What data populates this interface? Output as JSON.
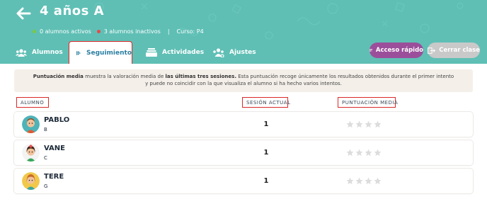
{
  "header": {
    "title": "4 años A",
    "active_label": "0 alumnos activos",
    "inactive_label": "3 alumnos inactivos",
    "separator": "|",
    "course_label": "Curso: P4",
    "colors": {
      "background": "#5fbfb5",
      "active_dot": "#7ac943",
      "inactive_dot": "#e84a4a"
    }
  },
  "tabs": [
    {
      "label": "Alumnos",
      "icon": "users-icon"
    },
    {
      "label": "Seguimiento",
      "icon": "chart-bars-icon",
      "active": true
    },
    {
      "label": "Actividades",
      "icon": "stack-icon"
    },
    {
      "label": "Ajustes",
      "icon": "users-gear-icon"
    }
  ],
  "actions": {
    "quick_access": "Acceso rápido",
    "close_class": "Cerrar clase"
  },
  "info": {
    "part1": "Puntuación media",
    "part2": " muestra la valoración media de ",
    "part3": "las últimas tres sesiones.",
    "part4": " Esta puntuación recoge únicamente los resultados obtenidos durante el primer intento y puede no coincidir con la que visualiza el alumno si ha hecho varios intentos."
  },
  "table": {
    "columns": {
      "student": "ALUMNO",
      "session": "SESIÓN ACTUAL",
      "score": "PUNTUACIÓN MEDIA"
    },
    "rows": [
      {
        "name": "PABLO",
        "group": "B",
        "session": "1",
        "stars": 0,
        "avatar": "boy-avatar"
      },
      {
        "name": "VANE",
        "group": "C",
        "session": "1",
        "stars": 0,
        "avatar": "girl-avatar"
      },
      {
        "name": "TERE",
        "group": "G",
        "session": "1",
        "stars": 0,
        "avatar": "girl-avatar"
      }
    ]
  }
}
